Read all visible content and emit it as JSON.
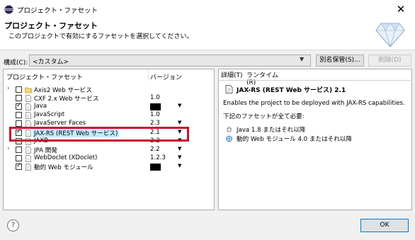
{
  "window": {
    "title": "プロジェクト・ファセット",
    "close_label": "✕"
  },
  "header": {
    "title": "プロジェクト・ファセット",
    "description": "このプロジェクトで有効にするファセットを選択してください。"
  },
  "config": {
    "label": "構成(C):",
    "value": "<カスタム>",
    "saveas_label": "別名保管(S)...",
    "delete_label": "削除(D)"
  },
  "facet_table": {
    "col_facet": "プロジェクト・ファセット",
    "col_version": "バージョン",
    "rows": [
      {
        "name": "Axis2 Web サービス",
        "version": "",
        "checked": false,
        "expander": true,
        "icon": "folder-icon",
        "redacted": false,
        "dropdown": false
      },
      {
        "name": "CXF 2.x Web サービス",
        "version": "1.0",
        "checked": false,
        "expander": false,
        "icon": "page-icon",
        "redacted": false,
        "dropdown": false
      },
      {
        "name": "Java",
        "version": "",
        "checked": true,
        "expander": false,
        "icon": "page-icon",
        "redacted": true,
        "dropdown": true
      },
      {
        "name": "JavaScript",
        "version": "1.0",
        "checked": false,
        "expander": false,
        "icon": "page-icon",
        "redacted": false,
        "dropdown": false
      },
      {
        "name": "JavaServer Faces",
        "version": "2.3",
        "checked": false,
        "expander": false,
        "icon": "page-icon",
        "redacted": false,
        "dropdown": true
      },
      {
        "name": "JAX-RS (REST Web サービス)",
        "version": "2.1",
        "checked": true,
        "expander": false,
        "icon": "page-icon",
        "redacted": false,
        "dropdown": true,
        "selected": true
      },
      {
        "name": "JAXB",
        "version": "2.2",
        "checked": false,
        "expander": false,
        "icon": "page-icon",
        "redacted": false,
        "dropdown": true
      },
      {
        "name": "JPA 開発",
        "version": "2.2",
        "checked": false,
        "expander": true,
        "icon": "page-icon",
        "redacted": false,
        "dropdown": true
      },
      {
        "name": "WebDoclet (XDoclet)",
        "version": "1.2.3",
        "checked": false,
        "expander": false,
        "icon": "page-icon",
        "redacted": false,
        "dropdown": true
      },
      {
        "name": "動的 Web モジュール",
        "version": "",
        "checked": true,
        "expander": false,
        "icon": "page-icon",
        "redacted": true,
        "dropdown": true
      }
    ]
  },
  "details": {
    "tab_details": "詳細(T)",
    "tab_runtimes": "ランタイム(R)",
    "title": "JAX-RS (REST Web サービス) 2.1",
    "description": "Enables the project to be deployed with JAX-RS capabilities.",
    "requires_label": "下記のファセットが全て必要:",
    "requirements": [
      "Java 1.8 またはそれ以降",
      "動的 Web モジュール 4.0 またはそれ以降"
    ]
  },
  "footer": {
    "help": "?",
    "ok_label": "OK"
  },
  "colors": {
    "selection": "#cce8ff",
    "highlight_box": "#c8102e",
    "ok_border": "#0078d7"
  }
}
